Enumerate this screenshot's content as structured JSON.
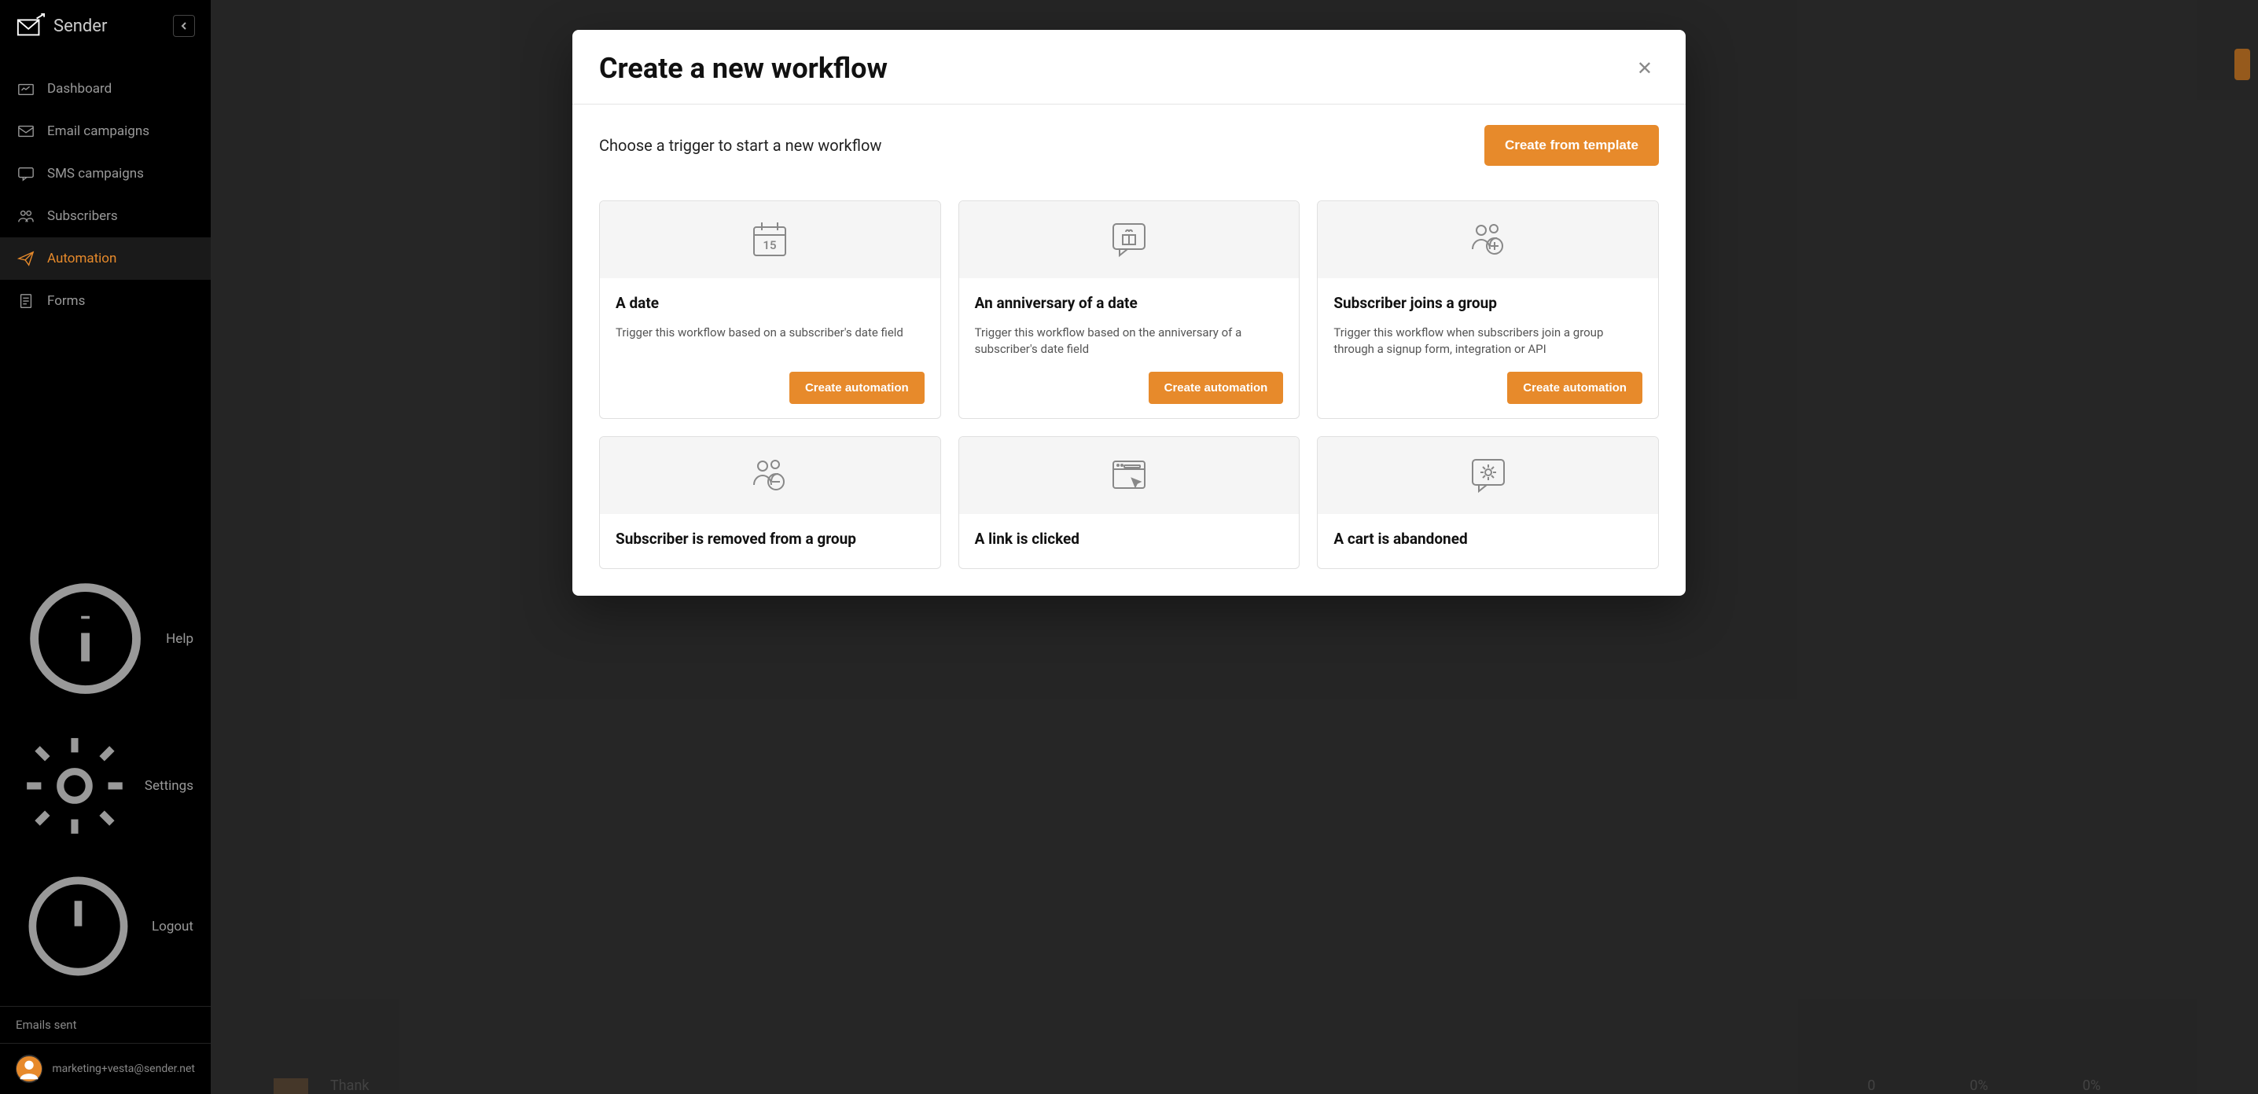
{
  "brand": "Sender",
  "sidebar": {
    "items": [
      {
        "label": "Dashboard"
      },
      {
        "label": "Email campaigns"
      },
      {
        "label": "SMS campaigns"
      },
      {
        "label": "Subscribers"
      },
      {
        "label": "Automation"
      },
      {
        "label": "Forms"
      }
    ],
    "footer_items": [
      {
        "label": "Help"
      },
      {
        "label": "Settings"
      },
      {
        "label": "Logout"
      }
    ],
    "emails_sent_label": "Emails sent",
    "user": {
      "email": "marketing+vesta@sender.net"
    }
  },
  "modal": {
    "title": "Create a new workflow",
    "subtitle": "Choose a trigger to start a new workflow",
    "create_from_template_label": "Create from template",
    "create_automation_label": "Create automation",
    "triggers": [
      {
        "title": "A date",
        "desc": "Trigger this workflow based on a subscriber's date field"
      },
      {
        "title": "An anniversary of a date",
        "desc": "Trigger this workflow based on the anniversary of a subscriber's date field"
      },
      {
        "title": "Subscriber joins a group",
        "desc": "Trigger this workflow when subscribers join a group through a signup form, integration or API"
      },
      {
        "title": "Subscriber is removed from a group",
        "desc": ""
      },
      {
        "title": "A link is clicked",
        "desc": ""
      },
      {
        "title": "A cart is abandoned",
        "desc": ""
      }
    ]
  },
  "background": {
    "thank_partial": "Thank",
    "stat_count": "0",
    "stat_pct1": "0%",
    "stat_pct2": "0%"
  }
}
